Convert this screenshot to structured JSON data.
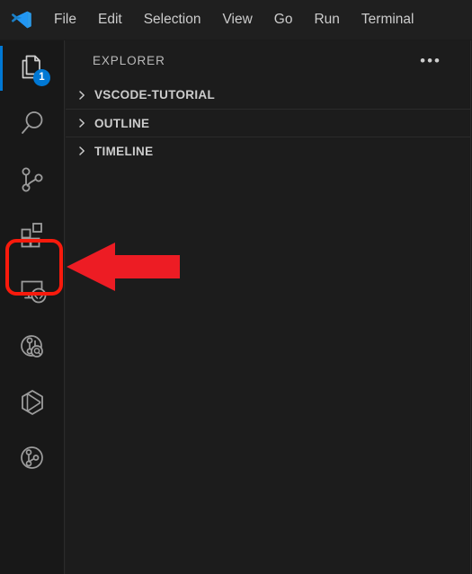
{
  "window": {
    "title": "Visual Studio Code",
    "logo_icon": "vscode-logo-icon"
  },
  "menubar": {
    "items": [
      {
        "label": "File"
      },
      {
        "label": "Edit"
      },
      {
        "label": "Selection"
      },
      {
        "label": "View"
      },
      {
        "label": "Go"
      },
      {
        "label": "Run"
      },
      {
        "label": "Terminal"
      }
    ]
  },
  "activitybar": {
    "items": [
      {
        "name": "explorer",
        "icon": "files-icon",
        "active": true,
        "badge": "1"
      },
      {
        "name": "search",
        "icon": "search-icon",
        "active": false,
        "badge": ""
      },
      {
        "name": "source-control",
        "icon": "source-control-icon",
        "active": false,
        "badge": ""
      },
      {
        "name": "extensions",
        "icon": "extensions-icon",
        "active": false,
        "badge": "",
        "highlighted": true
      },
      {
        "name": "remote-explorer",
        "icon": "remote-explorer-icon",
        "active": false,
        "badge": ""
      },
      {
        "name": "testing",
        "icon": "testing-icon",
        "active": false,
        "badge": ""
      },
      {
        "name": "docker",
        "icon": "docker-cube-icon",
        "active": false,
        "badge": ""
      },
      {
        "name": "git-graph",
        "icon": "git-graph-icon",
        "active": false,
        "badge": ""
      }
    ]
  },
  "sidebar": {
    "title": "EXPLORER",
    "more_actions_label": "•••",
    "sections": [
      {
        "label": "VSCODE-TUTORIAL",
        "expanded": false
      },
      {
        "label": "OUTLINE",
        "expanded": false
      },
      {
        "label": "TIMELINE",
        "expanded": false
      }
    ]
  },
  "annotations": {
    "highlight": {
      "target": "extensions",
      "shape": "rounded-rect",
      "color": "#f81a0c"
    },
    "arrow": {
      "direction": "left",
      "points_to": "extensions-icon",
      "color": "#ed1c24"
    }
  },
  "colors": {
    "accent": "#0078d4",
    "annotation_red": "#f81a0c",
    "activitybar_bg": "#181818",
    "sidebar_bg": "#1c1c1c",
    "titlebar_bg": "#1f1f1f",
    "foreground": "#cccccc",
    "icon_stroke": "#9d9d9d"
  }
}
